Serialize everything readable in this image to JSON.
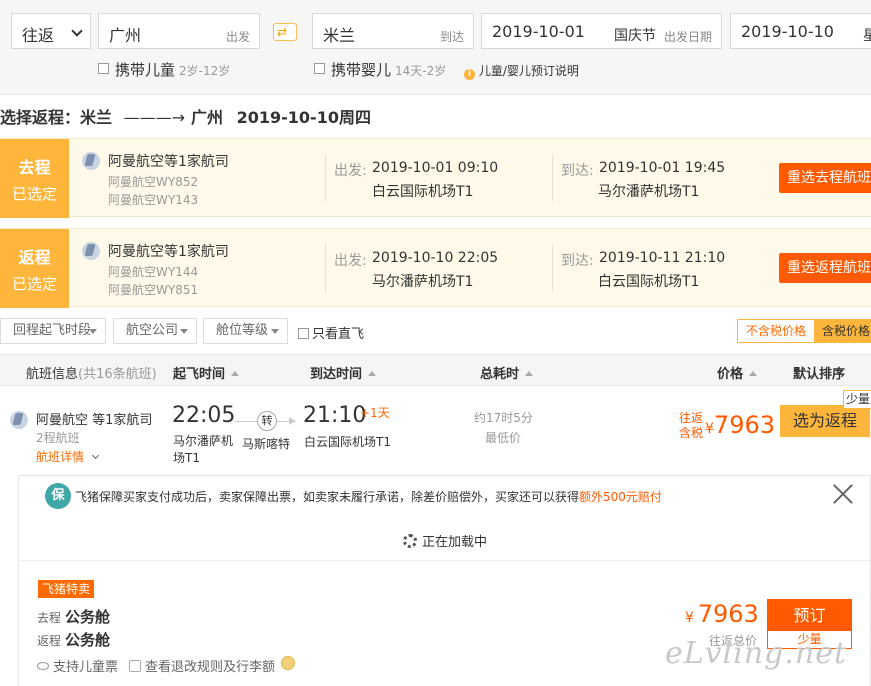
{
  "search": {
    "trip_type": "往返",
    "from_city": "广州",
    "from_suffix": "出发",
    "to_city": "米兰",
    "to_suffix": "到达",
    "depart_date": "2019-10-01",
    "depart_holiday": "国庆节",
    "depart_suffix": "出发日期",
    "return_date": "2019-10-10",
    "return_suffix": "星",
    "child_label": "携带儿童",
    "child_age": "2岁-12岁",
    "infant_label": "携带婴儿",
    "infant_age": "14天-2岁",
    "help_text": "儿童/婴儿预订说明"
  },
  "return_header": {
    "prefix": "选择返程：",
    "from": "米兰",
    "arrow": "———→",
    "to": "广州",
    "date": "2019-10-10周四"
  },
  "legs": [
    {
      "tag1": "去程",
      "tag2": "已选定",
      "airline": "阿曼航空等1家航司",
      "flight1": "阿曼航空WY852",
      "flight2": "阿曼航空WY143",
      "dep_label": "出发:",
      "dep_time": "2019-10-01 09:10",
      "dep_airport": "白云国际机场T1",
      "arr_label": "到达:",
      "arr_time": "2019-10-01 19:45",
      "arr_airport": "马尔潘萨机场T1",
      "button": "重选去程航班"
    },
    {
      "tag1": "返程",
      "tag2": "已选定",
      "airline": "阿曼航空等1家航司",
      "flight1": "阿曼航空WY144",
      "flight2": "阿曼航空WY851",
      "dep_label": "出发:",
      "dep_time": "2019-10-10 22:05",
      "dep_airport": "马尔潘萨机场T1",
      "arr_label": "到达:",
      "arr_time": "2019-10-11 21:10",
      "arr_airport": "白云国际机场T1",
      "button": "重选返程航班"
    }
  ],
  "filters": {
    "time": "回程起飞时段",
    "airline": "航空公司",
    "cabin": "舱位等级",
    "direct_only": "只看直飞",
    "price_ex_tax": "不含税价格",
    "price_inc_tax": "含税价格"
  },
  "table_header": {
    "info": "航班信息",
    "count": "(共16条航班)",
    "dep": "起飞时间",
    "arr": "到达时间",
    "duration": "总耗时",
    "price": "价格",
    "sort": "默认排序"
  },
  "flight": {
    "airline": "阿曼航空 等1家航司",
    "legs": "2程航班",
    "details": "航班详情",
    "dep_time": "22:05",
    "dep_airport_l1": "马尔潘萨机",
    "dep_airport_l2": "场T1",
    "transfer": "转",
    "transfer_city": "马斯喀特",
    "arr_time": "21:10",
    "arr_plus": "+1天",
    "arr_airport": "白云国际机场T1",
    "duration": "约17时5分",
    "lowest": "最低价",
    "price_l1": "往返",
    "price_l2": "含税",
    "currency": "¥",
    "price": "7963",
    "button": "选为返程",
    "badge": "少量"
  },
  "panel": {
    "shield": "保",
    "guarantee_text": "飞猪保障买家支付成功后，卖家保障出票，如卖家未履行承诺，除差价赔偿外，买家还可以获得",
    "guarantee_highlight": "额外500元赔付",
    "loading": "正在加载中",
    "seller_tag": "飞猪特卖",
    "out_label": "去程",
    "out_cabin": "公务舱",
    "ret_label": "返程",
    "ret_cabin": "公务舱",
    "child_ticket": "支持儿童票",
    "refund_rules": "查看退改规则及行李额",
    "currency": "¥",
    "price": "7963",
    "price_note": "往返总价",
    "book": "预订",
    "stock": "少量"
  },
  "watermark": "eLvling.net"
}
